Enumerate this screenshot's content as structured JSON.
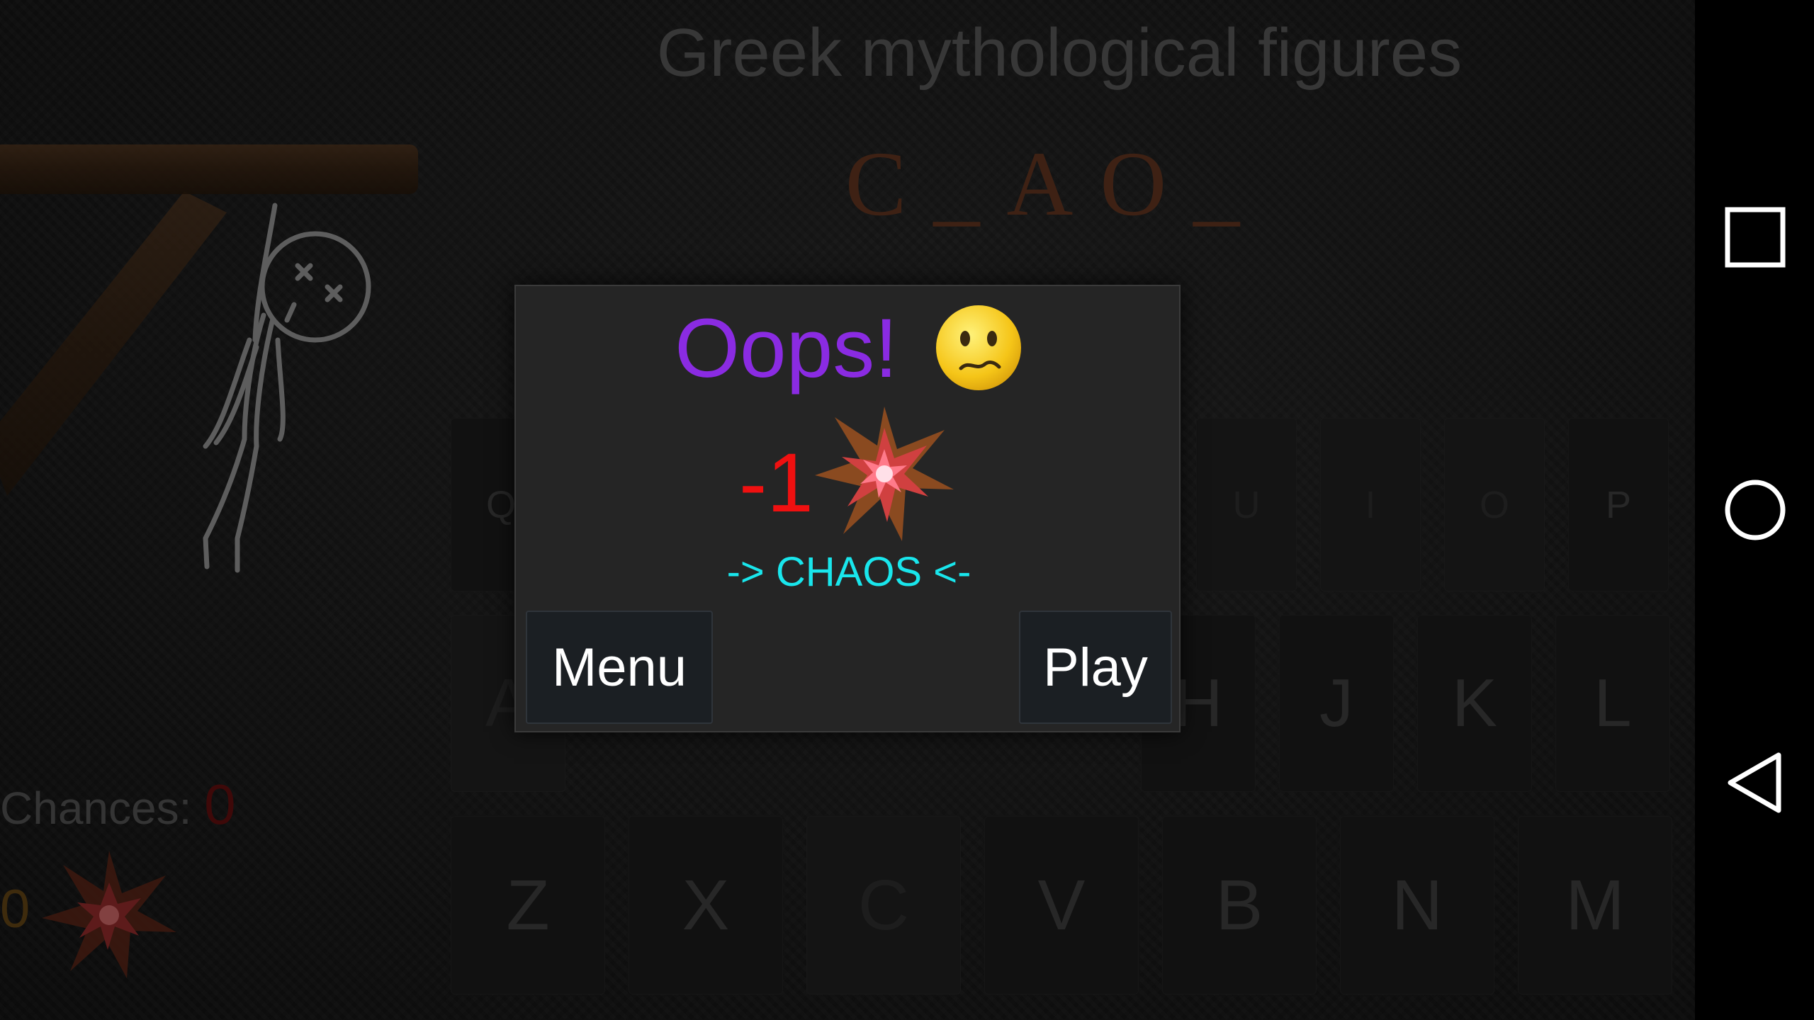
{
  "game": {
    "category": "Greek mythological figures",
    "word_display": "C_AO_",
    "chances_label": "Chances:",
    "chances_value": "0",
    "bonus_count": "0"
  },
  "keyboard": {
    "row1": [
      "Q",
      "U",
      "I",
      "O",
      "P"
    ],
    "row2": [
      "A",
      "H",
      "J",
      "K",
      "L"
    ],
    "row3": [
      "Z",
      "X",
      "C",
      "V",
      "B",
      "N",
      "M"
    ]
  },
  "dialog": {
    "title": "Oops!",
    "penalty": "-1",
    "answer": "-> CHAOS <-",
    "menu_label": "Menu",
    "play_label": "Play"
  },
  "navbar": {
    "icons": [
      "recents-icon",
      "home-icon",
      "back-icon"
    ]
  },
  "colors": {
    "title": "#8a2be2",
    "penalty": "#f01010",
    "answer": "#19e6ec",
    "word": "#6b3a24"
  }
}
